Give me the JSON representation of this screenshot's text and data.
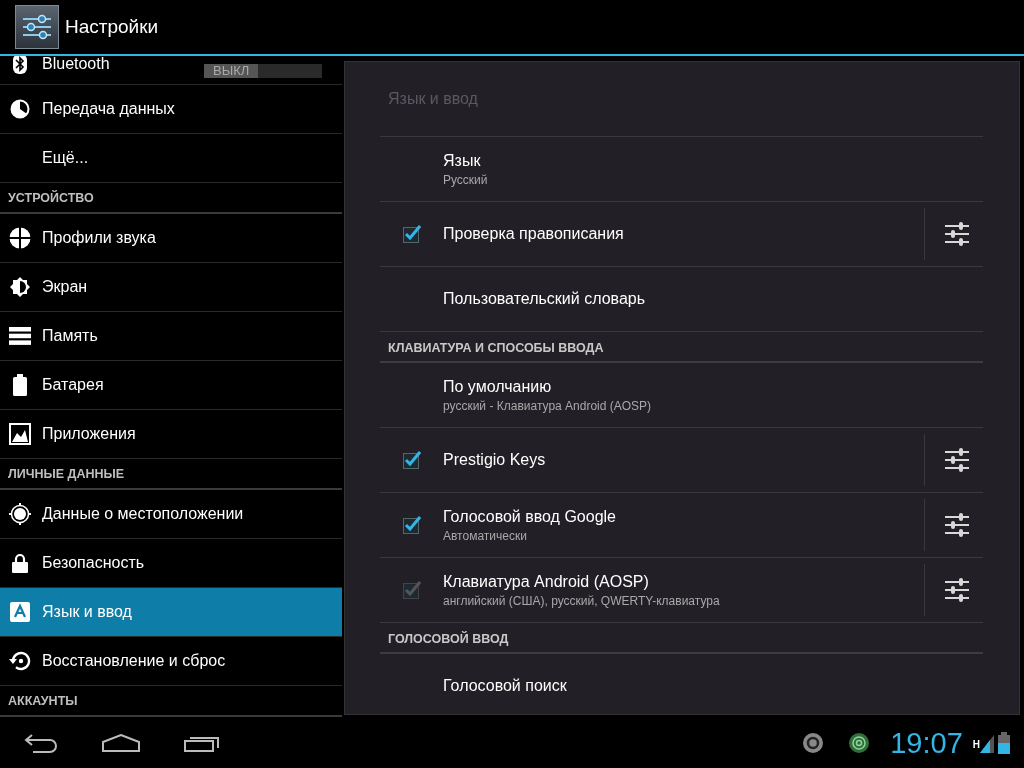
{
  "action_bar": {
    "title": "Настройки"
  },
  "sidebar": {
    "items": [
      {
        "kind": "toggle",
        "label": "Bluetooth",
        "toggle_label": "ВЫКЛ",
        "on": false,
        "selected": false
      },
      {
        "kind": "item",
        "label": "Передача данных",
        "selected": false
      },
      {
        "kind": "item",
        "label": "Ещё...",
        "selected": false
      },
      {
        "kind": "header",
        "label": "УСТРОЙСТВО"
      },
      {
        "kind": "item",
        "label": "Профили звука",
        "selected": false
      },
      {
        "kind": "item",
        "label": "Экран",
        "selected": false
      },
      {
        "kind": "item",
        "label": "Память",
        "selected": false
      },
      {
        "kind": "item",
        "label": "Батарея",
        "selected": false
      },
      {
        "kind": "item",
        "label": "Приложения",
        "selected": false
      },
      {
        "kind": "header",
        "label": "ЛИЧНЫЕ ДАННЫЕ"
      },
      {
        "kind": "item",
        "label": "Данные о местоположении",
        "selected": false
      },
      {
        "kind": "item",
        "label": "Безопасность",
        "selected": false
      },
      {
        "kind": "item",
        "label": "Язык и ввод",
        "selected": true
      },
      {
        "kind": "item",
        "label": "Восстановление и сброс",
        "selected": false
      },
      {
        "kind": "header",
        "label": "АККАУНТЫ"
      }
    ]
  },
  "panel": {
    "title": "Язык и ввод",
    "rows": [
      {
        "kind": "plain",
        "title": "Язык",
        "subtitle": "Русский"
      },
      {
        "kind": "checkbox",
        "title": "Проверка правописания",
        "checked": true,
        "disabled": false,
        "settings": true
      },
      {
        "kind": "plain",
        "title": "Пользовательский словарь"
      },
      {
        "kind": "header",
        "title": "КЛАВИАТУРА И СПОСОБЫ ВВОДА"
      },
      {
        "kind": "plain",
        "title": "По умолчанию",
        "subtitle": "русский - Клавиатура Android (AOSP)"
      },
      {
        "kind": "checkbox",
        "title": "Prestigio Keys",
        "checked": true,
        "disabled": false,
        "settings": true
      },
      {
        "kind": "checkbox",
        "title": "Голосовой ввод Google",
        "subtitle": "Автоматически",
        "checked": true,
        "disabled": false,
        "settings": true
      },
      {
        "kind": "checkbox",
        "title": "Клавиатура Android (AOSP)",
        "subtitle": "английский (США), русский, QWERTY-клавиатура",
        "checked": true,
        "disabled": true,
        "settings": true
      },
      {
        "kind": "header",
        "title": "ГОЛОСОВОЙ ВВОД"
      },
      {
        "kind": "plain",
        "title": "Голосовой поиск"
      }
    ]
  },
  "system_bar": {
    "time": "19:07",
    "network_type": "H"
  }
}
